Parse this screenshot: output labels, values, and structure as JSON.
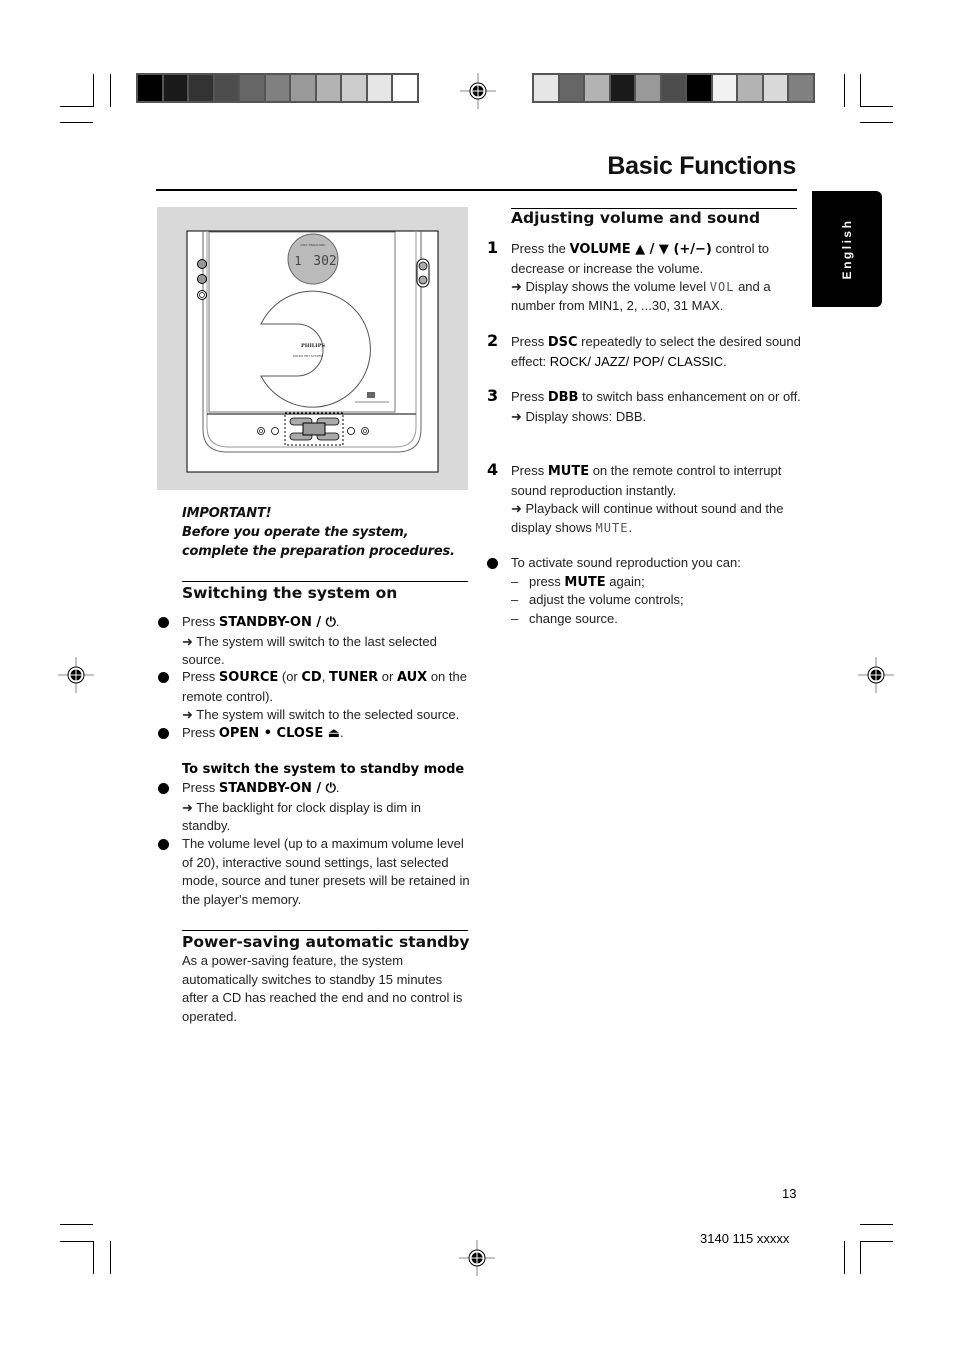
{
  "page": {
    "title": "Basic Functions",
    "language_tab": "English",
    "page_number": "13",
    "doc_code": "3140 115 xxxxx"
  },
  "color_bars": {
    "left": [
      "#000000",
      "#1a1a1a",
      "#333333",
      "#4d4d4d",
      "#666666",
      "#808080",
      "#999999",
      "#b3b3b3",
      "#cccccc",
      "#e6e6e6",
      "#ffffff"
    ],
    "right": [
      "#e6e6e6",
      "#666666",
      "#b3b3b3",
      "#1a1a1a",
      "#999999",
      "#4d4d4d",
      "#000000",
      "#f2f2f2",
      "#b3b3b3",
      "#d9d9d9",
      "#808080"
    ]
  },
  "figure": {
    "brand": "PHILIPS",
    "subtitle": "MICRO HIFI SYSTEM",
    "display_track": "1",
    "display_time": "302",
    "description": "Front panel illustration of CD micro system"
  },
  "important": {
    "label": "IMPORTANT!",
    "text": "Before you operate the system, complete the preparation procedures."
  },
  "switching_on": {
    "heading": "Switching the system on",
    "items": [
      {
        "prefix": "Press ",
        "bold": "STANDBY-ON / ⏻",
        "suffix": ".",
        "result": "➜ The system will switch to the last selected source."
      },
      {
        "prefix": "Press ",
        "bold": "SOURCE",
        "middle1": " (or ",
        "bold2": "CD",
        "middle2": ", ",
        "bold3": "TUNER",
        "middle3": " or ",
        "bold4": "AUX",
        "suffix": " on the remote control).",
        "result": "➜ The system will switch to the selected source."
      },
      {
        "prefix": "Press ",
        "bold": "OPEN • CLOSE ⏏",
        "suffix": "."
      }
    ],
    "standby_heading": "To switch the system to standby mode",
    "standby_items": [
      {
        "prefix": "Press ",
        "bold": "STANDBY-ON / ⏻",
        "suffix": ".",
        "result": "➜ The backlight for clock display is dim in standby."
      },
      {
        "text": "The volume level (up to a maximum volume level of 20), interactive sound settings, last selected mode, source and tuner presets will be retained in the player's memory."
      }
    ]
  },
  "power_saving": {
    "heading": "Power-saving automatic standby",
    "text": "As a power-saving feature, the system automatically switches to standby 15 minutes after a CD has reached the end and no control is operated."
  },
  "adjusting": {
    "heading": "Adjusting volume and sound",
    "steps": [
      {
        "number": "1",
        "prefix": "Press the ",
        "bold": "VOLUME ▲ / ▼  (+/−)",
        "suffix": " control to decrease or increase the volume.",
        "result_prefix": "➜ Display shows the volume level ",
        "lcd": "VOL",
        "result_suffix": " and a number from MIN1, 2, ...30, 31 MAX."
      },
      {
        "number": "2",
        "prefix": "Press ",
        "bold": "DSC",
        "suffix": " repeatedly to select the desired sound effect: ",
        "effects": "ROCK/ JAZZ/ POP/ CLASSIC",
        "end": "."
      },
      {
        "number": "3",
        "prefix": "Press ",
        "bold": "DBB",
        "suffix": " to switch bass enhancement on or off.",
        "result": "➜ Display shows: DBB."
      },
      {
        "number": "4",
        "prefix": "Press ",
        "bold": "MUTE",
        "suffix": " on the remote control to interrupt sound reproduction instantly.",
        "result_prefix": "➜ Playback will continue without sound and the display shows ",
        "lcd": "MUTE",
        "result_suffix": "."
      }
    ],
    "reactivate": {
      "intro": "To activate sound reproduction you can:",
      "options": [
        {
          "prefix": "press ",
          "bold": "MUTE",
          "suffix": " again;"
        },
        {
          "text": "adjust the volume controls;"
        },
        {
          "text": "change source."
        }
      ]
    }
  }
}
